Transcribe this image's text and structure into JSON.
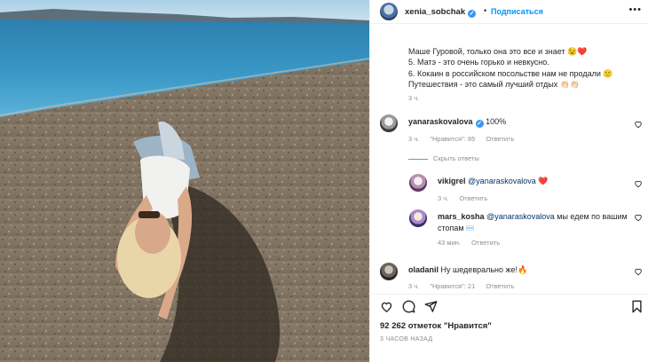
{
  "post": {
    "username": "xenia_sobchak",
    "follow_label": "Подписаться",
    "separator": "•",
    "more": "•••",
    "caption_lines": [
      "Маше Гуровой, только она это все и знает 😉❤️",
      "5. Матэ - это очень горько и невкусно.",
      "6. Кокаин в российском посольстве нам не продали 🙂",
      "Путешествия - это самый лучший отдых 👏🏻👏🏻"
    ],
    "caption_time": "3 ч."
  },
  "comments": [
    {
      "username": "yanaraskovalova",
      "verified": true,
      "text": "100%",
      "time": "3 ч.",
      "likes": "\"Нравится\": 85",
      "reply": "Ответить"
    }
  ],
  "hide_replies": "Скрыть ответы",
  "replies": [
    {
      "username": "vikigrel",
      "mention": "@yanaraskovalova",
      "text": " ❤️",
      "time": "3 ч.",
      "reply": "Ответить"
    },
    {
      "username": "mars_kosha",
      "mention": "@yanaraskovalova",
      "text_line1": " мы едем по вашим",
      "text_line2": "стопам",
      "time": "43 мин.",
      "reply": "Ответить"
    }
  ],
  "comment2": {
    "username": "oladanil",
    "text": "Ну шедеврально же!🔥",
    "time": "3 ч.",
    "likes": "\"Нравится\": 21",
    "reply": "Ответить"
  },
  "footer": {
    "likes": "92 262 отметок \"Нравится\"",
    "date": "3 ЧАСОВ НАЗАД"
  },
  "icons": {
    "like": "heart-icon",
    "comment": "comment-icon",
    "share": "share-icon",
    "save": "bookmark-icon",
    "verified": "verified-badge-icon"
  },
  "colors": {
    "accent": "#0095f6",
    "verified": "#3897f0",
    "muted": "#8e8e8e",
    "like_heart": "#ed4956"
  }
}
